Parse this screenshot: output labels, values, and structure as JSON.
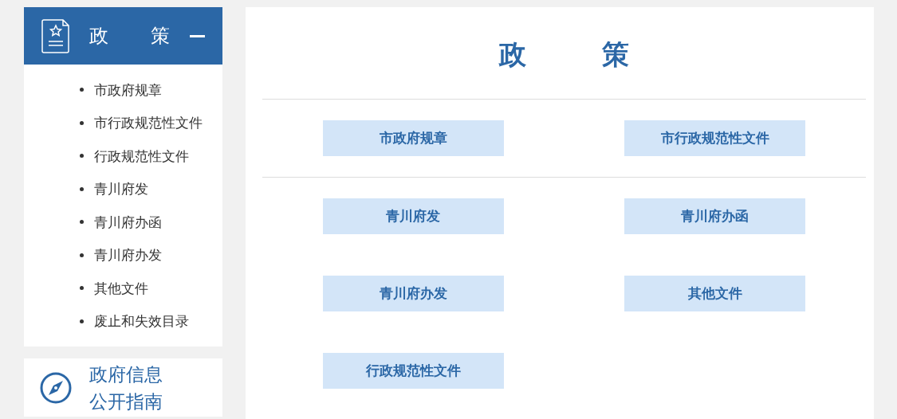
{
  "sidebar": {
    "header": {
      "title": "政　策",
      "expanded": true
    },
    "items": [
      "市政府规章",
      "市行政规范性文件",
      "行政规范性文件",
      "青川府发",
      "青川府办函",
      "青川府办发",
      "其他文件",
      "废止和失效目录"
    ],
    "guide": {
      "lines": [
        "政府信息",
        "公开指南"
      ]
    }
  },
  "main": {
    "title": "政　策",
    "groups": [
      {
        "buttons": [
          "市政府规章",
          "市行政规范性文件"
        ]
      },
      {
        "buttons": [
          "青川府发",
          "青川府办函",
          "青川府办发",
          "其他文件",
          "行政规范性文件"
        ]
      }
    ]
  }
}
